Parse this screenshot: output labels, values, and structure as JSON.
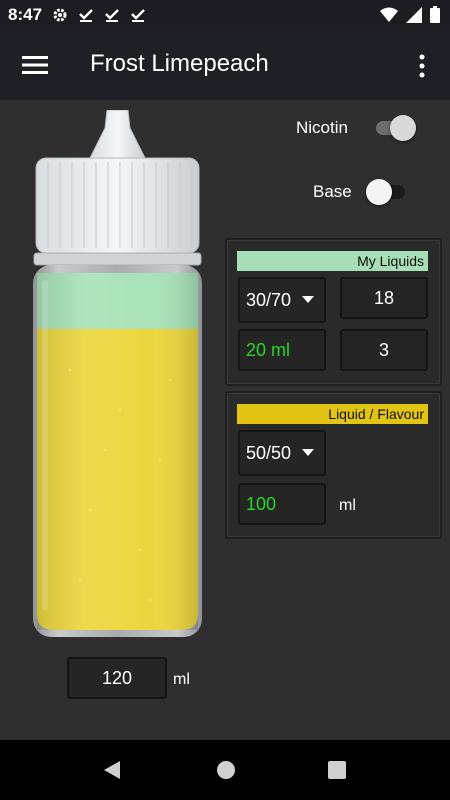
{
  "status_bar": {
    "time": "8:47",
    "icons": [
      "gear-icon",
      "download-done-icon",
      "download-done-icon",
      "download-done-icon",
      "wifi-icon",
      "signal-icon",
      "battery-icon"
    ]
  },
  "app_bar": {
    "title": "Frost Limepeach",
    "menu_icon": "hamburger-menu-icon",
    "more_icon": "more-vert-icon"
  },
  "bottle": {
    "top_fill_color": "#a8e2b8",
    "bottom_fill_color": "#ecd63e",
    "top_fraction": 0.167,
    "bottom_fraction": 0.833
  },
  "toggles": {
    "nicotin": {
      "label": "Nicotin",
      "on": true
    },
    "base": {
      "label": "Base",
      "on": false
    }
  },
  "my_liquids": {
    "header": "My Liquids",
    "header_color": "#a6dfb5",
    "ratio": "30/70",
    "strength": "18",
    "amount": "20 ml",
    "count": "3"
  },
  "liquid_flavour": {
    "header": "Liquid / Flavour",
    "header_color": "#e2c512",
    "ratio": "50/50",
    "amount": "100",
    "unit": "ml"
  },
  "total": {
    "value": "120",
    "unit": "ml"
  },
  "nav": {
    "back": "back-icon",
    "home": "home-icon",
    "recents": "recents-icon"
  }
}
